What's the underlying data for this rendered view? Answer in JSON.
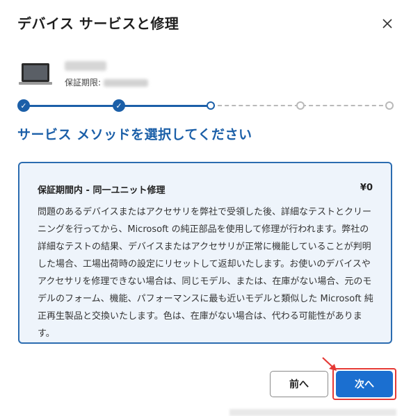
{
  "dialog": {
    "title": "デバイス サービスと修理",
    "close_label": "閉じる"
  },
  "device": {
    "warranty_label": "保証期限:"
  },
  "steps": [
    {
      "state": "done"
    },
    {
      "state": "done"
    },
    {
      "state": "current"
    },
    {
      "state": "todo"
    },
    {
      "state": "todo"
    }
  ],
  "section_heading": "サービス メソッドを選択してください",
  "option": {
    "title": "保証期間内 - 同一ユニット修理",
    "price": "¥0",
    "description": "問題のあるデバイスまたはアクセサリを弊社で受領した後、詳細なテストとクリーニングを行ってから、Microsoft の純正部品を使用して修理が行われます。弊社の詳細なテストの結果、デバイスまたはアクセサリが正常に機能していることが判明した場合、工場出荷時の設定にリセットして返却いたします。お使いのデバイスやアクセサリを修理できない場合は、同じモデル、または、在庫がない場合、元のモデルのフォーム、機能、パフォーマンスに最も近いモデルと類似した Microsoft 純正再生製品と交換いたします。色は、在庫がない場合は、代わる可能性があります。"
  },
  "buttons": {
    "prev": "前へ",
    "next": "次へ"
  },
  "colors": {
    "accent": "#1b5fa8",
    "primary_button": "#1b6fd0",
    "highlight": "#e53935"
  }
}
